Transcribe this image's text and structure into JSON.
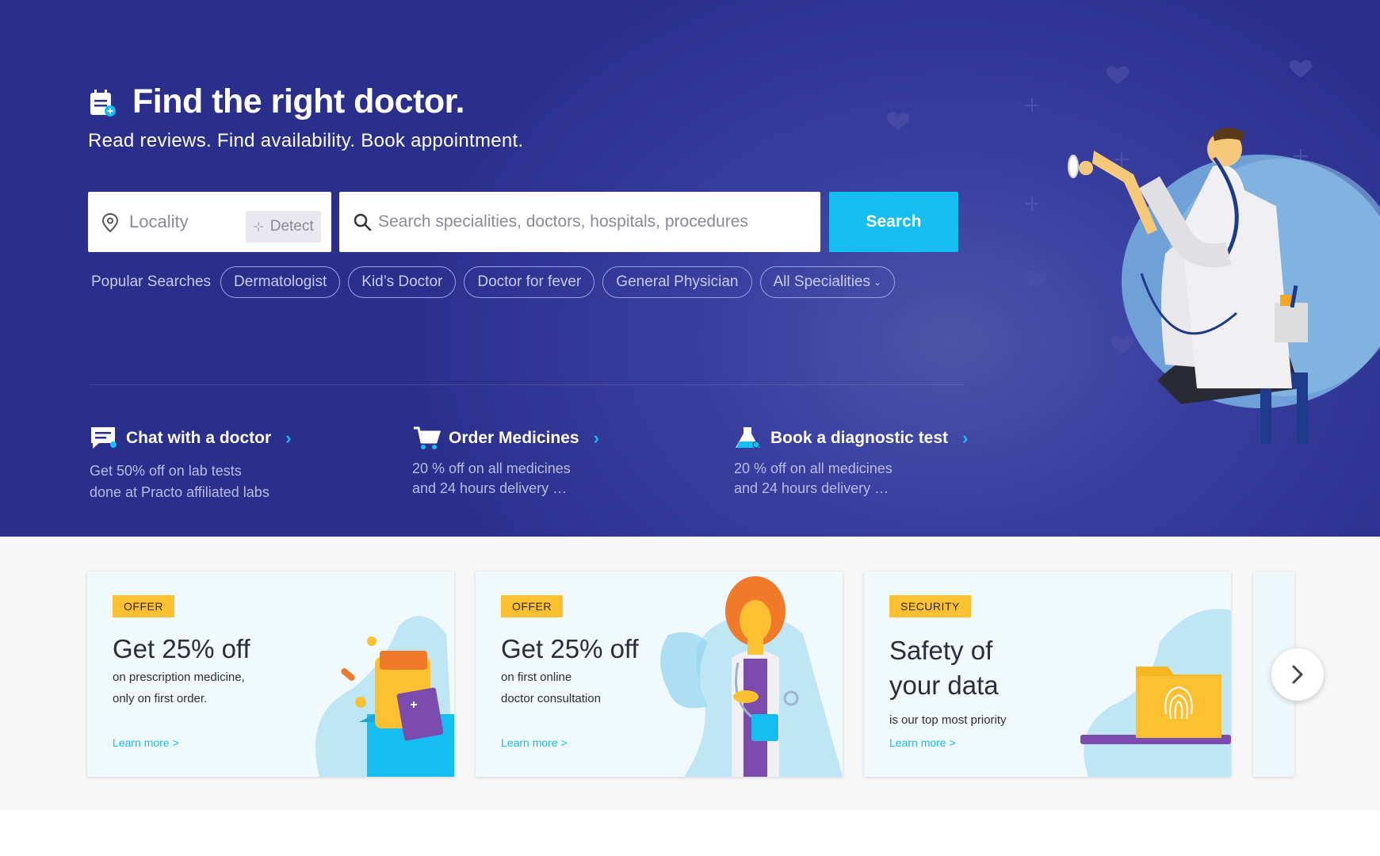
{
  "hero": {
    "title": "Find the right doctor.",
    "subtitle": "Read reviews. Find availability. Book appointment.",
    "locality_placeholder": "Locality",
    "detect_label": "Detect",
    "search_placeholder": "Search specialities, doctors, hospitals, procedures",
    "search_button": "Search",
    "popular_label": "Popular Searches",
    "chips": [
      "Dermatologist",
      "Kid’s Doctor",
      "Doctor for fever",
      "General Physician",
      "All Specialities"
    ]
  },
  "services": [
    {
      "title": "Chat with a doctor",
      "desc_line1": "Get 50% off on lab tests",
      "desc_line2": "done at Practo affiliated labs",
      "icon": "chat-icon"
    },
    {
      "title": "Order Medicines",
      "desc_line1": "20 % off on all medicines",
      "desc_line2": "and 24 hours delivery …",
      "icon": "cart-icon"
    },
    {
      "title": "Book a diagnostic test",
      "desc_line1": "20 % off on all medicines",
      "desc_line2": "and 24 hours delivery …",
      "icon": "flask-icon"
    }
  ],
  "offers": [
    {
      "badge": "OFFER",
      "title": "Get 25% off",
      "sub_line1": "on prescription medicine,",
      "sub_line2": "only on first order.",
      "link": "Learn more >"
    },
    {
      "badge": "OFFER",
      "title": "Get 25% off",
      "sub_line1": "on first online",
      "sub_line2": "doctor consultation",
      "link": "Learn more >"
    },
    {
      "badge": "SECURITY",
      "title_line1": "Safety of",
      "title_line2": "your data",
      "sub_line1": "is our top most priority",
      "link": "Learn more >"
    }
  ],
  "colors": {
    "hero_bg": "#2a2f8c",
    "accent": "#14bef0",
    "badge": "#fdc031"
  }
}
